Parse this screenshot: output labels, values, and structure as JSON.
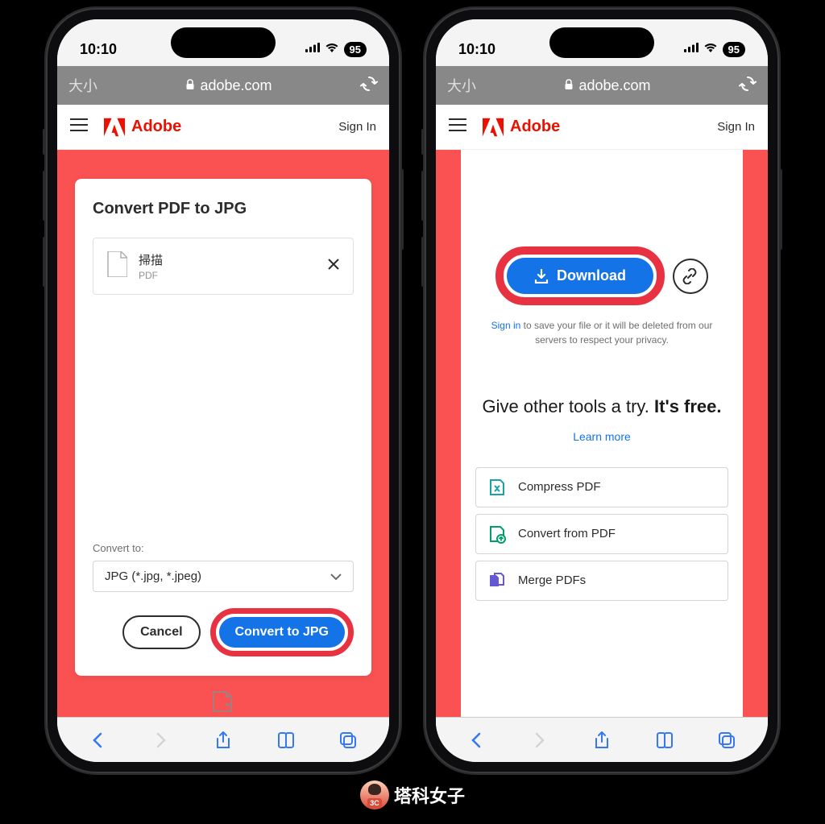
{
  "status": {
    "time": "10:10",
    "battery": "95"
  },
  "safari": {
    "text_size": "大小",
    "domain": "adobe.com"
  },
  "adobe_header": {
    "brand": "Adobe",
    "sign_in": "Sign In"
  },
  "phone1": {
    "title": "Convert PDF to JPG",
    "file": {
      "name": "掃描",
      "type": "PDF"
    },
    "convert_to_label": "Convert to:",
    "format_selected": "JPG (*.jpg, *.jpeg)",
    "cancel": "Cancel",
    "convert_btn": "Convert to JPG"
  },
  "phone2": {
    "download": "Download",
    "note_prefix": "Sign in",
    "note_rest": " to save your file or it will be deleted from our servers to respect your privacy.",
    "promo_a": "Give other tools a try. ",
    "promo_b": "It's free.",
    "learn_more": "Learn more",
    "tools": {
      "compress": "Compress PDF",
      "convert_from": "Convert from PDF",
      "merge": "Merge PDFs"
    }
  },
  "watermark": "塔科女子"
}
